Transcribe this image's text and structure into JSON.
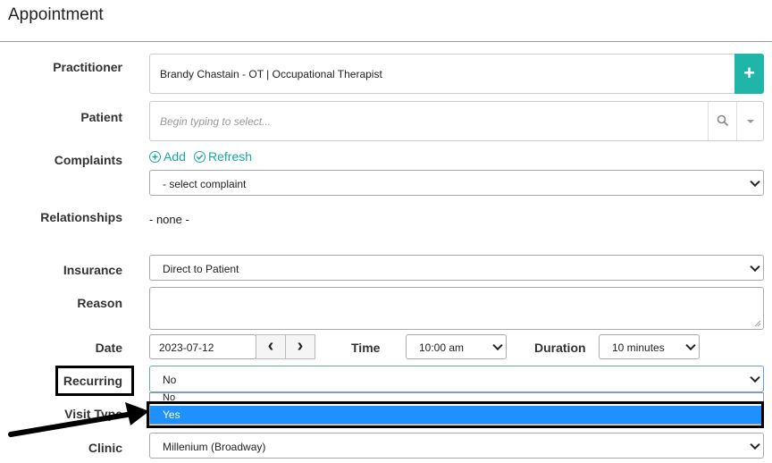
{
  "header": {
    "title": "Appointment"
  },
  "form": {
    "practitioner_label": "Practitioner",
    "practitioner_value": "Brandy Chastain - OT | Occupational Therapist",
    "practitioner_add": "+",
    "patient_label": "Patient",
    "patient_placeholder": "Begin typing to select...",
    "complaints_label": "Complaints",
    "complaints_add": "Add",
    "complaints_refresh": "Refresh",
    "complaints_select": "- select complaint",
    "relationships_label": "Relationships",
    "relationships_value": "- none -",
    "insurance_label": "Insurance",
    "insurance_value": "Direct to Patient",
    "reason_label": "Reason",
    "date_label": "Date",
    "date_value": "2023-07-12",
    "prev": "‹",
    "next": "›",
    "time_label": "Time",
    "time_value": "10:00 am",
    "duration_label": "Duration",
    "duration_value": "10 minutes",
    "recurring_label": "Recurring",
    "recurring_value": "No",
    "recurring_options": [
      "No",
      "Yes"
    ],
    "visit_type_label": "Visit Type",
    "clinic_label": "Clinic",
    "clinic_value": "Millenium (Broadway)"
  },
  "colors": {
    "accent": "#1fb5a8",
    "selection": "#1e90ff"
  }
}
